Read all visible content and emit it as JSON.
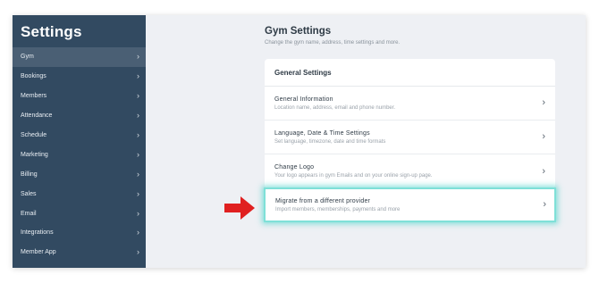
{
  "sidebar": {
    "title": "Settings",
    "items": [
      {
        "label": "Gym"
      },
      {
        "label": "Bookings"
      },
      {
        "label": "Members"
      },
      {
        "label": "Attendance"
      },
      {
        "label": "Schedule"
      },
      {
        "label": "Marketing"
      },
      {
        "label": "Billing"
      },
      {
        "label": "Sales"
      },
      {
        "label": "Email"
      },
      {
        "label": "Integrations"
      },
      {
        "label": "Member App"
      }
    ],
    "chevron": "›"
  },
  "main": {
    "title": "Gym Settings",
    "subtitle": "Change the gym name, address, time settings and more.",
    "card": {
      "header": "General Settings",
      "rows": [
        {
          "title": "General Information",
          "description": "Location name, address, email and phone number."
        },
        {
          "title": "Language, Date & Time Settings",
          "description": "Set language, timezone, date and time formats"
        },
        {
          "title": "Change Logo",
          "description": "Your logo appears in gym Emails and on your online sign-up page."
        }
      ]
    },
    "highlight": {
      "title": "Migrate from a different provider",
      "description": "Import members, memberships, payments and more"
    },
    "chevron": "›"
  },
  "colors": {
    "sidebar_bg": "#324a61",
    "sidebar_active": "#4a5f74",
    "highlight_glow": "#58d6cd",
    "arrow": "#e02020"
  },
  "icons": {
    "arrow": "red-right-arrow-icon",
    "chevron": "chevron-right-icon"
  }
}
